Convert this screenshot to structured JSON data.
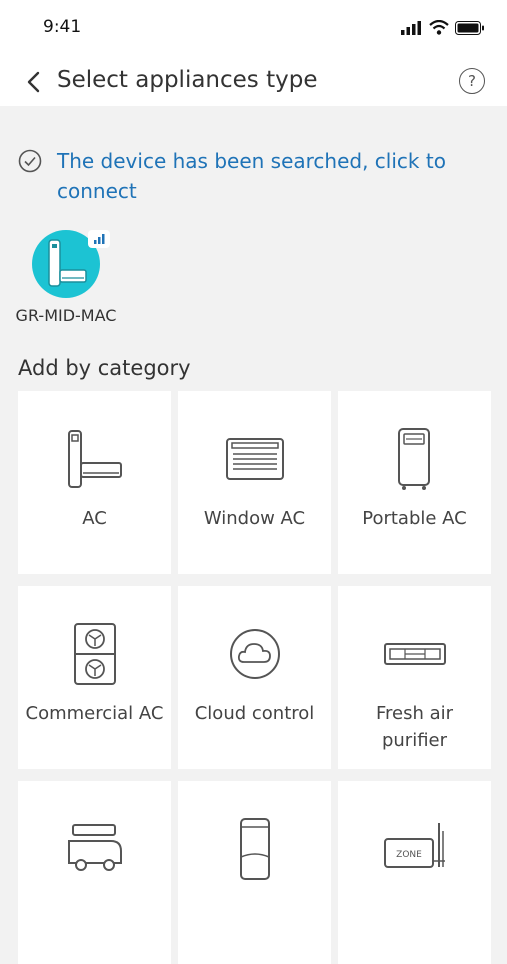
{
  "status": {
    "time": "9:41"
  },
  "nav": {
    "title": "Select appliances type",
    "back_icon": "chevron-left-icon",
    "help_label": "?"
  },
  "found": {
    "message": "The device has been searched, click to connect"
  },
  "device": {
    "name": "GR-MID-MAC",
    "accent": "#1cc3d3"
  },
  "section": {
    "title": "Add by category"
  },
  "categories": [
    {
      "label": "AC",
      "icon": "split-ac-icon"
    },
    {
      "label": "Window AC",
      "icon": "window-ac-icon"
    },
    {
      "label": "Portable AC",
      "icon": "portable-ac-icon"
    },
    {
      "label": "Commercial AC",
      "icon": "commercial-ac-icon"
    },
    {
      "label": "Cloud control",
      "icon": "cloud-icon"
    },
    {
      "label": "Fresh air purifier",
      "icon": "fresh-air-icon"
    },
    {
      "label": "",
      "icon": "rv-ac-icon"
    },
    {
      "label": "",
      "icon": "column-icon"
    },
    {
      "label": "",
      "icon": "zone-controller-icon"
    }
  ],
  "colors": {
    "link_blue": "#1f73b7",
    "background": "#f2f2f2"
  }
}
